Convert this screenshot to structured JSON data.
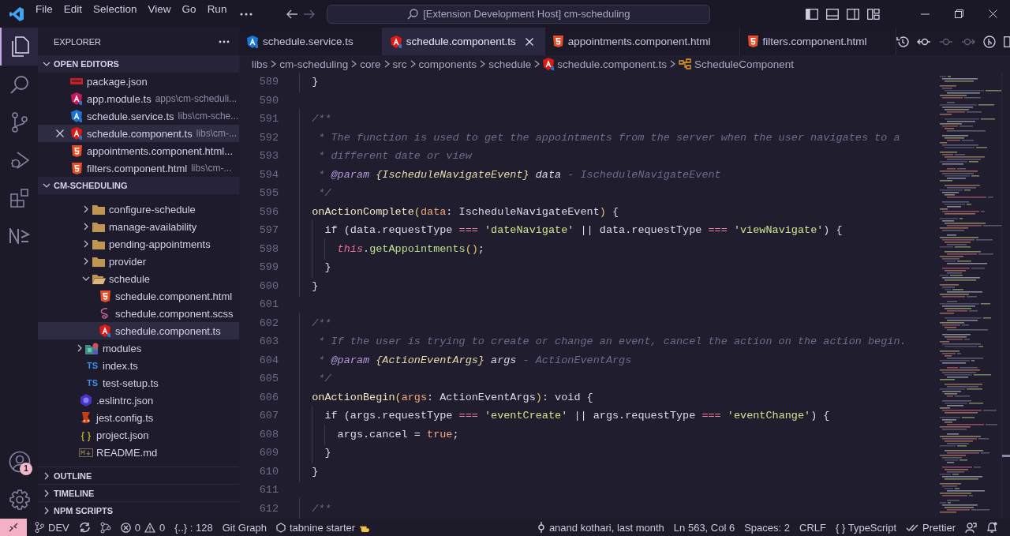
{
  "title_bar": {
    "menu": [
      "File",
      "Edit",
      "Selection",
      "View",
      "Go",
      "Run"
    ],
    "search": "[Extension Development Host] cm-scheduling"
  },
  "activity_bar": {
    "items": [
      {
        "kind": "explorer",
        "selected": true
      },
      {
        "kind": "search",
        "selected": false
      },
      {
        "kind": "source-control",
        "selected": false
      },
      {
        "kind": "run-debug",
        "selected": false
      },
      {
        "kind": "extensions",
        "selected": false
      },
      {
        "kind": "nx",
        "selected": false
      }
    ],
    "bottom": [
      {
        "kind": "accounts",
        "badge": "1"
      },
      {
        "kind": "settings"
      }
    ]
  },
  "sidebar": {
    "title": "EXPLORER",
    "open_editors": {
      "title": "OPEN EDITORS",
      "expanded": true,
      "items": [
        {
          "name": "package.json",
          "kind": "npm",
          "selected": false
        },
        {
          "name": "app.module.ts",
          "path": "apps\\cm-scheduli...",
          "kind": "ng-module",
          "selected": false
        },
        {
          "name": "schedule.service.ts",
          "path": "libs\\cm-sche...",
          "kind": "ng-service",
          "selected": false
        },
        {
          "name": "schedule.component.ts",
          "path": "libs\\cm-...",
          "kind": "ng-component",
          "selected": true
        },
        {
          "name": "appointments.component.html...",
          "kind": "html",
          "selected": false
        },
        {
          "name": "filters.component.html",
          "path": "libs\\cm-...",
          "kind": "html",
          "selected": false
        }
      ]
    },
    "project": {
      "title": "CM-SCHEDULING",
      "expanded": true,
      "tree": [
        {
          "children": [
            {
              "children": [
                {
                  "label": "configure-schedule",
                  "kind": "folder",
                  "expanded": false,
                  "selected": false
                },
                {
                  "label": "manage-availability",
                  "kind": "folder",
                  "expanded": false,
                  "selected": false
                },
                {
                  "label": "pending-appointments",
                  "kind": "folder",
                  "expanded": false,
                  "selected": false
                },
                {
                  "label": "provider",
                  "kind": "folder",
                  "expanded": false,
                  "selected": false
                },
                {
                  "label": "schedule",
                  "kind": "folder",
                  "expanded": true,
                  "selected": false,
                  "children": [
                    {
                      "label": "schedule.component.html",
                      "kind": "html",
                      "selected": false
                    },
                    {
                      "label": "schedule.component.scss",
                      "kind": "scss",
                      "selected": false
                    },
                    {
                      "label": "schedule.component.ts",
                      "kind": "ng-component",
                      "selected": true
                    }
                  ]
                }
              ]
            },
            {
              "label": "modules",
              "kind": "modules-folder",
              "expanded": false,
              "selected": false
            },
            {
              "label": "index.ts",
              "kind": "ts",
              "glyph": "TS",
              "selected": false
            },
            {
              "label": "test-setup.ts",
              "kind": "ts",
              "glyph": "TS",
              "selected": false
            }
          ]
        },
        {
          "label": ".eslintrc.json",
          "kind": "eslint",
          "selected": false
        },
        {
          "label": "jest.config.ts",
          "kind": "jest",
          "selected": false
        },
        {
          "label": "project.json",
          "kind": "json",
          "glyph": "{ }",
          "selected": false
        },
        {
          "label": "README.md",
          "kind": "markdown",
          "selected": false
        }
      ]
    },
    "sections": [
      {
        "title": "OUTLINE",
        "expanded": false
      },
      {
        "title": "TIMELINE",
        "expanded": false
      },
      {
        "title": "NPM SCRIPTS",
        "expanded": false
      }
    ]
  },
  "tabs": [
    {
      "name": "schedule.service.ts",
      "kind": "ng-service",
      "selected": false
    },
    {
      "name": "schedule.component.ts",
      "kind": "ng-component",
      "selected": true
    },
    {
      "name": "appointments.component.html",
      "kind": "html",
      "selected": false
    },
    {
      "name": "filters.component.html",
      "kind": "html",
      "selected": false
    }
  ],
  "breadcrumb": {
    "path": [
      "libs",
      "cm-scheduling",
      "core",
      "src",
      "components",
      "schedule"
    ],
    "file": "schedule.component.ts",
    "symbol": "ScheduleComponent"
  },
  "code": [
    {
      "num": "589",
      "tokens": [
        {
          "kind": "punct",
          "text": "  }"
        }
      ]
    },
    {
      "num": "590"
    },
    {
      "num": "591",
      "tokens": [
        {
          "kind": "comment",
          "text": "  /**"
        }
      ]
    },
    {
      "num": "592",
      "tokens": [
        {
          "kind": "comment",
          "text": "   * The function is used to get the appointments from the server when the user navigates to a"
        }
      ]
    },
    {
      "num": "593",
      "tokens": [
        {
          "kind": "comment",
          "text": "   * different date or view"
        }
      ]
    },
    {
      "num": "594",
      "tokens": [
        {
          "kind": "comment",
          "text": "   * "
        },
        {
          "kind": "doctag",
          "text": "@param"
        },
        {
          "kind": "doctype",
          "text": " {IscheduleNavigateEvent}"
        },
        {
          "kind": "docparam",
          "text": " data"
        },
        {
          "kind": "comment",
          "text": " - IscheduleNavigateEvent"
        }
      ]
    },
    {
      "num": "595",
      "tokens": [
        {
          "kind": "comment",
          "text": "   */"
        }
      ]
    },
    {
      "num": "596",
      "tokens": [
        {
          "kind": "fn",
          "text": "  onActionComplete"
        },
        {
          "kind": "paren",
          "text": "("
        },
        {
          "kind": "param",
          "text": "data"
        },
        {
          "kind": "plain",
          "text": ": IscheduleNavigateEvent"
        },
        {
          "kind": "paren",
          "text": ")"
        },
        {
          "kind": "plain",
          "text": " {"
        }
      ]
    },
    {
      "num": "597",
      "tokens": [
        {
          "kind": "keyword",
          "text": "    if"
        },
        {
          "kind": "plain",
          "text": " (data.requestType"
        },
        {
          "kind": "op",
          "text": " === "
        },
        {
          "kind": "string",
          "text": "'dateNavigate'"
        },
        {
          "kind": "plain",
          "text": " || data.requestType"
        },
        {
          "kind": "op",
          "text": " === "
        },
        {
          "kind": "string",
          "text": "'viewNavigate'"
        },
        {
          "kind": "plain",
          "text": ") {"
        }
      ]
    },
    {
      "num": "598",
      "tokens": [
        {
          "kind": "this",
          "text": "      this"
        },
        {
          "kind": "plain",
          "text": "."
        },
        {
          "kind": "call",
          "text": "getAppointments"
        },
        {
          "kind": "paren",
          "text": "()"
        },
        {
          "kind": "plain",
          "text": ";"
        }
      ]
    },
    {
      "num": "599",
      "tokens": [
        {
          "kind": "plain",
          "text": "    }"
        }
      ]
    },
    {
      "num": "600",
      "tokens": [
        {
          "kind": "punct",
          "text": "  }"
        }
      ]
    },
    {
      "num": "601"
    },
    {
      "num": "602",
      "tokens": [
        {
          "kind": "comment",
          "text": "  /**"
        }
      ]
    },
    {
      "num": "603",
      "tokens": [
        {
          "kind": "comment",
          "text": "   * If the user is trying to create or change an event, cancel the action on the action begin."
        }
      ]
    },
    {
      "num": "604",
      "tokens": [
        {
          "kind": "comment",
          "text": "   * "
        },
        {
          "kind": "doctag",
          "text": "@param"
        },
        {
          "kind": "doctype",
          "text": " {ActionEventArgs}"
        },
        {
          "kind": "docparam",
          "text": " args"
        },
        {
          "kind": "comment",
          "text": " - ActionEventArgs"
        }
      ]
    },
    {
      "num": "605",
      "tokens": [
        {
          "kind": "comment",
          "text": "   */"
        }
      ]
    },
    {
      "num": "606",
      "tokens": [
        {
          "kind": "fn",
          "text": "  onActionBegin"
        },
        {
          "kind": "paren",
          "text": "("
        },
        {
          "kind": "param",
          "text": "args"
        },
        {
          "kind": "plain",
          "text": ": ActionEventArgs"
        },
        {
          "kind": "paren",
          "text": ")"
        },
        {
          "kind": "plain",
          "text": ": void {"
        }
      ]
    },
    {
      "num": "607",
      "tokens": [
        {
          "kind": "keyword",
          "text": "    if"
        },
        {
          "kind": "plain",
          "text": " (args.requestType"
        },
        {
          "kind": "op",
          "text": " === "
        },
        {
          "kind": "string",
          "text": "'eventCreate'"
        },
        {
          "kind": "plain",
          "text": " || args.requestType"
        },
        {
          "kind": "op",
          "text": " === "
        },
        {
          "kind": "string",
          "text": "'eventChange'"
        },
        {
          "kind": "plain",
          "text": ") {"
        }
      ]
    },
    {
      "num": "608",
      "tokens": [
        {
          "kind": "plain",
          "text": "      args.cancel = "
        },
        {
          "kind": "bool",
          "text": "true"
        },
        {
          "kind": "plain",
          "text": ";"
        }
      ]
    },
    {
      "num": "609",
      "tokens": [
        {
          "kind": "plain",
          "text": "    }"
        }
      ]
    },
    {
      "num": "610",
      "tokens": [
        {
          "kind": "punct",
          "text": "  }"
        }
      ]
    },
    {
      "num": "611"
    },
    {
      "num": "612",
      "tokens": [
        {
          "kind": "comment",
          "text": "  /**"
        }
      ]
    }
  ],
  "status_bar": {
    "left": [
      {
        "kind": "remote"
      },
      {
        "kind": "branch",
        "text": "DEV"
      },
      {
        "kind": "sync"
      },
      {
        "kind": "graph"
      },
      {
        "kind": "problems",
        "errors": "0",
        "warnings": "0"
      },
      {
        "kind": "plain",
        "text": "{..} : 128"
      },
      {
        "kind": "plain",
        "text": "Git Graph"
      },
      {
        "kind": "tabnine",
        "text": "tabnine starter"
      }
    ],
    "right": [
      {
        "kind": "blame",
        "text": "anand kothari, last month"
      },
      {
        "kind": "plain",
        "text": "Ln 563, Col 6"
      },
      {
        "kind": "plain",
        "text": "Spaces: 2"
      },
      {
        "kind": "plain",
        "text": "CRLF"
      },
      {
        "kind": "language",
        "glyph": "{ }",
        "text": "TypeScript"
      },
      {
        "kind": "prettier",
        "text": "Prettier"
      },
      {
        "kind": "feedback"
      },
      {
        "kind": "bell"
      }
    ]
  }
}
